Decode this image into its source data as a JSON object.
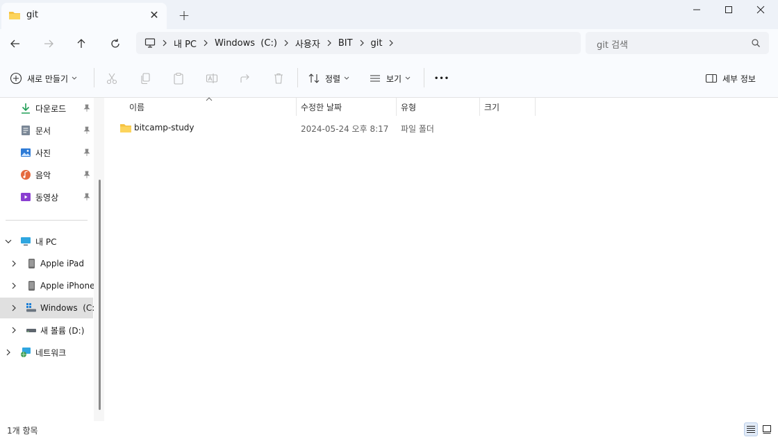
{
  "tab": {
    "title": "git",
    "close_glyph": "✕",
    "new_glyph": "+"
  },
  "window": {
    "colors": {
      "accent": "#0067c0",
      "folder": "#f5c242"
    }
  },
  "nav": {
    "breadcrumbs": [
      "내 PC",
      "Windows  (C:)",
      "사용자",
      "BIT",
      "git"
    ],
    "search_placeholder": "git 검색"
  },
  "toolbar": {
    "new_label": "새로 만들기",
    "sort_label": "정렬",
    "view_label": "보기",
    "more_glyph": "•••",
    "details_label": "세부 정보"
  },
  "sidebar": {
    "quick_access": [
      {
        "label": "다운로드",
        "icon": "download-icon"
      },
      {
        "label": "문서",
        "icon": "document-icon"
      },
      {
        "label": "사진",
        "icon": "pictures-icon"
      },
      {
        "label": "음악",
        "icon": "music-icon"
      },
      {
        "label": "동영상",
        "icon": "video-icon"
      }
    ],
    "tree": [
      {
        "label": "내 PC",
        "icon": "pc-icon",
        "expanded": true
      },
      {
        "label": "Apple iPad",
        "icon": "device-icon"
      },
      {
        "label": "Apple iPhone",
        "icon": "device-icon"
      },
      {
        "label": "Windows  (C:)",
        "icon": "windows-drive-icon",
        "selected": true
      },
      {
        "label": "새 볼륨 (D:)",
        "icon": "drive-icon"
      },
      {
        "label": "네트워크",
        "icon": "network-icon"
      }
    ]
  },
  "columns": [
    "이름",
    "수정한 날짜",
    "유형",
    "크기"
  ],
  "files": [
    {
      "name": "bitcamp-study",
      "modified": "2024-05-24 오후 8:17",
      "type": "파일 폴더",
      "size": ""
    }
  ],
  "status": {
    "item_count": "1개 항목"
  }
}
